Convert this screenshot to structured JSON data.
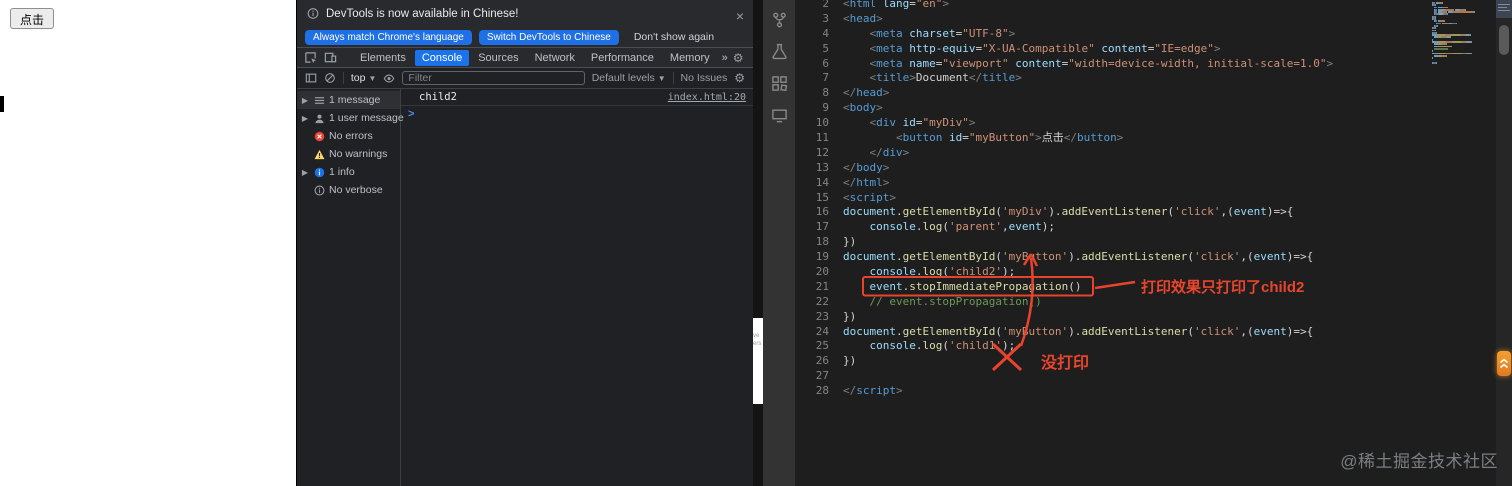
{
  "page": {
    "button_label": "点击"
  },
  "window_gap": {
    "fragments": [
      "ve",
      "ers"
    ]
  },
  "devtools": {
    "banner": {
      "message": "DevTools is now available in Chinese!",
      "primary_button": "Always match Chrome's language",
      "secondary_button": "Switch DevTools to Chinese",
      "dismiss_button": "Don't show again",
      "close": "×"
    },
    "tabs": [
      {
        "label": "Elements"
      },
      {
        "label": "Console"
      },
      {
        "label": "Sources"
      },
      {
        "label": "Network"
      },
      {
        "label": "Performance"
      },
      {
        "label": "Memory"
      }
    ],
    "active_tab": "Console",
    "more_tabs": "»",
    "toolbar": {
      "frame_selector": "top",
      "filter_placeholder": "Filter",
      "levels_label": "Default levels",
      "issues_label": "No Issues"
    },
    "sidebar": {
      "items": [
        {
          "label": "1 message"
        },
        {
          "label": "1 user message"
        },
        {
          "label": "No errors"
        },
        {
          "label": "No warnings"
        },
        {
          "label": "1 info"
        },
        {
          "label": "No verbose"
        }
      ]
    },
    "console": {
      "message": "child2",
      "source_link": "index.html:20",
      "prompt": ">"
    }
  },
  "editor": {
    "lines": [
      {
        "n": 2,
        "tokens": [
          [
            "pg",
            "<"
          ],
          [
            "tag",
            "html"
          ],
          [
            "txt",
            " "
          ],
          [
            "attr",
            "lang"
          ],
          [
            "pw",
            "="
          ],
          [
            "str",
            "\"en\""
          ],
          [
            "pg",
            ">"
          ]
        ]
      },
      {
        "n": 3,
        "tokens": [
          [
            "pg",
            "<"
          ],
          [
            "tag",
            "head"
          ],
          [
            "pg",
            ">"
          ]
        ]
      },
      {
        "n": 4,
        "tokens": [
          [
            "txt",
            "    "
          ],
          [
            "pg",
            "<"
          ],
          [
            "tag",
            "meta"
          ],
          [
            "txt",
            " "
          ],
          [
            "attr",
            "charset"
          ],
          [
            "pw",
            "="
          ],
          [
            "str",
            "\"UTF-8\""
          ],
          [
            "pg",
            ">"
          ]
        ]
      },
      {
        "n": 5,
        "tokens": [
          [
            "txt",
            "    "
          ],
          [
            "pg",
            "<"
          ],
          [
            "tag",
            "meta"
          ],
          [
            "txt",
            " "
          ],
          [
            "attr",
            "http-equiv"
          ],
          [
            "pw",
            "="
          ],
          [
            "str",
            "\"X-UA-Compatible\""
          ],
          [
            "txt",
            " "
          ],
          [
            "attr",
            "content"
          ],
          [
            "pw",
            "="
          ],
          [
            "str",
            "\"IE=edge\""
          ],
          [
            "pg",
            ">"
          ]
        ]
      },
      {
        "n": 6,
        "tokens": [
          [
            "txt",
            "    "
          ],
          [
            "pg",
            "<"
          ],
          [
            "tag",
            "meta"
          ],
          [
            "txt",
            " "
          ],
          [
            "attr",
            "name"
          ],
          [
            "pw",
            "="
          ],
          [
            "str",
            "\"viewport\""
          ],
          [
            "txt",
            " "
          ],
          [
            "attr",
            "content"
          ],
          [
            "pw",
            "="
          ],
          [
            "str",
            "\"width=device-width, initial-scale=1.0\""
          ],
          [
            "pg",
            ">"
          ]
        ]
      },
      {
        "n": 7,
        "tokens": [
          [
            "txt",
            "    "
          ],
          [
            "pg",
            "<"
          ],
          [
            "tag",
            "title"
          ],
          [
            "pg",
            ">"
          ],
          [
            "txt",
            "Document"
          ],
          [
            "pg",
            "</"
          ],
          [
            "tag",
            "title"
          ],
          [
            "pg",
            ">"
          ]
        ]
      },
      {
        "n": 8,
        "tokens": [
          [
            "pg",
            "</"
          ],
          [
            "tag",
            "head"
          ],
          [
            "pg",
            ">"
          ]
        ]
      },
      {
        "n": 9,
        "tokens": [
          [
            "pg",
            "<"
          ],
          [
            "tag",
            "body"
          ],
          [
            "pg",
            ">"
          ]
        ]
      },
      {
        "n": 10,
        "tokens": [
          [
            "txt",
            "    "
          ],
          [
            "pg",
            "<"
          ],
          [
            "tag",
            "div"
          ],
          [
            "txt",
            " "
          ],
          [
            "attr",
            "id"
          ],
          [
            "pw",
            "="
          ],
          [
            "str",
            "\"myDiv\""
          ],
          [
            "pg",
            ">"
          ]
        ]
      },
      {
        "n": 11,
        "tokens": [
          [
            "txt",
            "        "
          ],
          [
            "pg",
            "<"
          ],
          [
            "tag",
            "button"
          ],
          [
            "txt",
            " "
          ],
          [
            "attr",
            "id"
          ],
          [
            "pw",
            "="
          ],
          [
            "str",
            "\"myButton\""
          ],
          [
            "pg",
            ">"
          ],
          [
            "txt",
            "点击"
          ],
          [
            "pg",
            "</"
          ],
          [
            "tag",
            "button"
          ],
          [
            "pg",
            ">"
          ]
        ]
      },
      {
        "n": 12,
        "tokens": [
          [
            "txt",
            "    "
          ],
          [
            "pg",
            "</"
          ],
          [
            "tag",
            "div"
          ],
          [
            "pg",
            ">"
          ]
        ]
      },
      {
        "n": 13,
        "tokens": [
          [
            "pg",
            "</"
          ],
          [
            "tag",
            "body"
          ],
          [
            "pg",
            ">"
          ]
        ]
      },
      {
        "n": 14,
        "tokens": [
          [
            "pg",
            "</"
          ],
          [
            "tag",
            "html"
          ],
          [
            "pg",
            ">"
          ]
        ]
      },
      {
        "n": 15,
        "tokens": [
          [
            "pg",
            "<"
          ],
          [
            "tag",
            "script"
          ],
          [
            "pg",
            ">"
          ]
        ]
      },
      {
        "n": 16,
        "tokens": [
          [
            "id",
            "document"
          ],
          [
            "pw",
            "."
          ],
          [
            "fn",
            "getElementById"
          ],
          [
            "pw",
            "("
          ],
          [
            "str",
            "'myDiv'"
          ],
          [
            "pw",
            ")."
          ],
          [
            "fn",
            "addEventListener"
          ],
          [
            "pw",
            "("
          ],
          [
            "str",
            "'click'"
          ],
          [
            "pw",
            ",("
          ],
          [
            "id",
            "event"
          ],
          [
            "pw",
            ")=>{"
          ]
        ]
      },
      {
        "n": 17,
        "tokens": [
          [
            "txt",
            "    "
          ],
          [
            "id",
            "console"
          ],
          [
            "pw",
            "."
          ],
          [
            "fn",
            "log"
          ],
          [
            "pw",
            "("
          ],
          [
            "str",
            "'parent'"
          ],
          [
            "pw",
            ","
          ],
          [
            "id",
            "event"
          ],
          [
            "pw",
            ");"
          ]
        ]
      },
      {
        "n": 18,
        "tokens": [
          [
            "pw",
            "})"
          ]
        ]
      },
      {
        "n": 19,
        "tokens": [
          [
            "id",
            "document"
          ],
          [
            "pw",
            "."
          ],
          [
            "fn",
            "getElementById"
          ],
          [
            "pw",
            "("
          ],
          [
            "str",
            "'myButton'"
          ],
          [
            "pw",
            ")."
          ],
          [
            "fn",
            "addEventListener"
          ],
          [
            "pw",
            "("
          ],
          [
            "str",
            "'click'"
          ],
          [
            "pw",
            ",("
          ],
          [
            "id",
            "event"
          ],
          [
            "pw",
            ")=>{"
          ]
        ]
      },
      {
        "n": 20,
        "tokens": [
          [
            "txt",
            "    "
          ],
          [
            "id",
            "console"
          ],
          [
            "pw",
            "."
          ],
          [
            "fn",
            "log"
          ],
          [
            "pw",
            "("
          ],
          [
            "str",
            "'child2'"
          ],
          [
            "pw",
            ");"
          ]
        ]
      },
      {
        "n": 21,
        "tokens": [
          [
            "txt",
            "    "
          ],
          [
            "id",
            "event"
          ],
          [
            "pw",
            "."
          ],
          [
            "fn",
            "stopImmediatePropagation"
          ],
          [
            "pw",
            "()"
          ]
        ]
      },
      {
        "n": 22,
        "tokens": [
          [
            "txt",
            "    "
          ],
          [
            "cm",
            "// event.stopPropagation()"
          ]
        ]
      },
      {
        "n": 23,
        "tokens": [
          [
            "pw",
            "})"
          ]
        ]
      },
      {
        "n": 24,
        "tokens": [
          [
            "id",
            "document"
          ],
          [
            "pw",
            "."
          ],
          [
            "fn",
            "getElementById"
          ],
          [
            "pw",
            "("
          ],
          [
            "str",
            "'myButton'"
          ],
          [
            "pw",
            ")."
          ],
          [
            "fn",
            "addEventListener"
          ],
          [
            "pw",
            "("
          ],
          [
            "str",
            "'click'"
          ],
          [
            "pw",
            ",("
          ],
          [
            "id",
            "event"
          ],
          [
            "pw",
            ")=>{"
          ]
        ]
      },
      {
        "n": 25,
        "tokens": [
          [
            "txt",
            "    "
          ],
          [
            "id",
            "console"
          ],
          [
            "pw",
            "."
          ],
          [
            "fn",
            "log"
          ],
          [
            "pw",
            "("
          ],
          [
            "str",
            "'child1'"
          ],
          [
            "pw",
            ");"
          ]
        ]
      },
      {
        "n": 26,
        "tokens": [
          [
            "pw",
            "})"
          ]
        ]
      },
      {
        "n": 27,
        "tokens": []
      },
      {
        "n": 28,
        "tokens": [
          [
            "pg",
            "</"
          ],
          [
            "tag",
            "script"
          ],
          [
            "pg",
            ">"
          ]
        ]
      }
    ]
  },
  "annotations": {
    "highlight_note": "打印效果只打印了child2",
    "not_printed_note": "没打印"
  },
  "watermark": "@稀土掘金技术社区"
}
